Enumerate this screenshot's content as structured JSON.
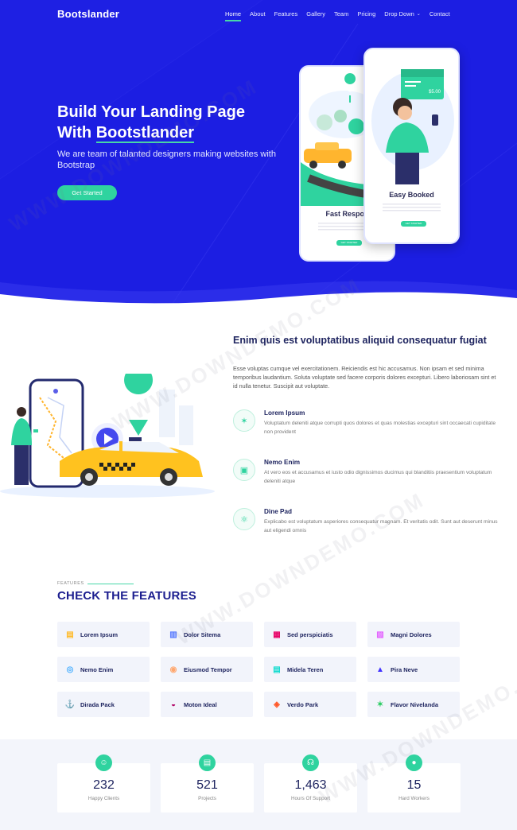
{
  "brand": "Bootslander",
  "nav": {
    "items": [
      "Home",
      "About",
      "Features",
      "Gallery",
      "Team",
      "Pricing",
      "Drop Down",
      "Contact"
    ]
  },
  "hero": {
    "title_line1": "Build Your Landing Page",
    "title_line2_prefix": "With ",
    "title_line2_highlight": "Bootstlander",
    "subtitle": "We are team of talanted designers making websites with Bootstrap",
    "button": "Get Started",
    "phone1_caption": "Fast Respon",
    "phone2_caption": "Easy Booked",
    "phone2_price": "$5.00",
    "phone_button": "GET STARTED"
  },
  "about": {
    "title": "Enim quis est voluptatibus aliquid consequatur fugiat",
    "text": "Esse voluptas cumque vel exercitationem. Reiciendis est hic accusamus. Non ipsam et sed minima temporibus laudantium. Soluta voluptate sed facere corporis dolores excepturi. Libero laboriosam sint et id nulla tenetur. Suscipit aut voluptate.",
    "items": [
      {
        "icon": "fingerprint-icon",
        "title": "Lorem Ipsum",
        "text": "Voluptatum deleniti atque corrupti quos dolores et quas molestias excepturi sint occaecati cupiditate non provident"
      },
      {
        "icon": "gift-icon",
        "title": "Nemo Enim",
        "text": "At vero eos et accusamus et iusto odio dignissimos ducimus qui blanditiis praesentium voluptatum deleniti atque"
      },
      {
        "icon": "atom-icon",
        "title": "Dine Pad",
        "text": "Explicabo est voluptatum asperiores consequatur magnam. Et veritatis odit. Sunt aut deserunt minus aut eligendi omnis"
      }
    ]
  },
  "features": {
    "label": "FEATURES",
    "title": "CHECK THE FEATURES",
    "cards": [
      {
        "label": "Lorem Ipsum",
        "icon": "store-icon",
        "color": "#ffbb2c"
      },
      {
        "label": "Dolor Sitema",
        "icon": "bar-chart-icon",
        "color": "#5578ff"
      },
      {
        "label": "Sed perspiciatis",
        "icon": "calendar-icon",
        "color": "#e80368"
      },
      {
        "label": "Magni Dolores",
        "icon": "paint-brush-icon",
        "color": "#e361ff"
      },
      {
        "label": "Nemo Enim",
        "icon": "database-icon",
        "color": "#47aeff"
      },
      {
        "label": "Eiusmod Tempor",
        "icon": "gradienter-icon",
        "color": "#ffa76e"
      },
      {
        "label": "Midela Teren",
        "icon": "file-list-icon",
        "color": "#11dbcf"
      },
      {
        "label": "Pira Neve",
        "icon": "price-tag-icon",
        "color": "#4233ff"
      },
      {
        "label": "Dirada Pack",
        "icon": "anchor-icon",
        "color": "#b2904f"
      },
      {
        "label": "Moton Ideal",
        "icon": "disc-icon",
        "color": "#b20969"
      },
      {
        "label": "Verdo Park",
        "icon": "base-station-icon",
        "color": "#ff5828"
      },
      {
        "label": "Flavor Nivelanda",
        "icon": "fingerprint-icon",
        "color": "#29cc61"
      }
    ]
  },
  "stats": [
    {
      "icon": "smile-icon",
      "number": "232",
      "label": "Happy Clients"
    },
    {
      "icon": "journal-icon",
      "number": "521",
      "label": "Projects"
    },
    {
      "icon": "headset-icon",
      "number": "1,463",
      "label": "Hours Of Support"
    },
    {
      "icon": "people-icon",
      "number": "15",
      "label": "Hard Workers"
    }
  ],
  "watermark": "WWW.DOWNDEMO.COM",
  "colors": {
    "hero_bg": "#1c1ee2",
    "accent": "#2fd39f",
    "heading": "#1f2560",
    "features_title": "#1c1e8f"
  }
}
